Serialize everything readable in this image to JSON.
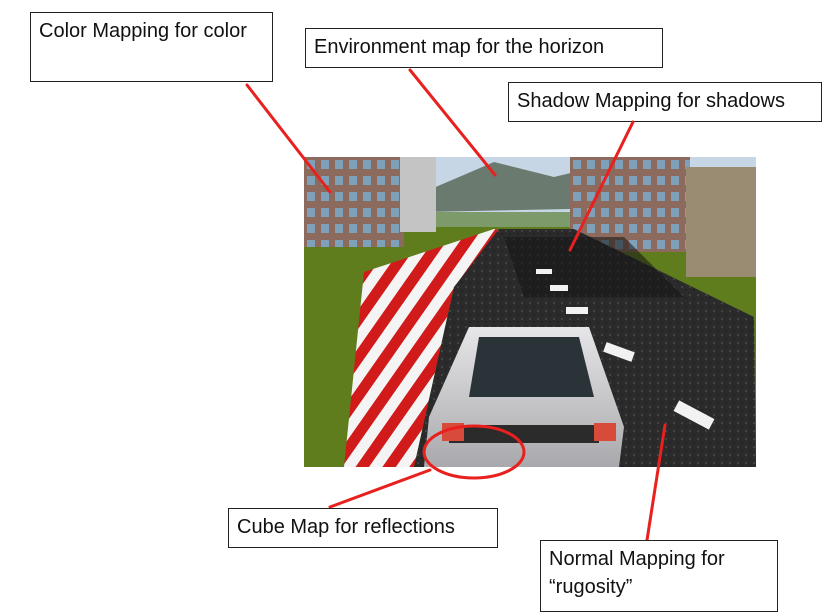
{
  "labels": {
    "color_mapping": "Color Mapping for color",
    "environment_map": "Environment map for the horizon",
    "shadow_mapping": "Shadow Mapping for shadows",
    "cube_map": "Cube Map for reflections",
    "normal_mapping": "Normal Mapping for “rugosity”"
  },
  "colors": {
    "arrow": "#e8201e",
    "grass": "#5f7d1d",
    "road": "#2b2b2b",
    "sky": "#c6d6e4",
    "curb_red": "#d11a1a",
    "curb_white": "#f4f4f4",
    "building": "#8c6a5e",
    "car": "#cfcfd1"
  }
}
